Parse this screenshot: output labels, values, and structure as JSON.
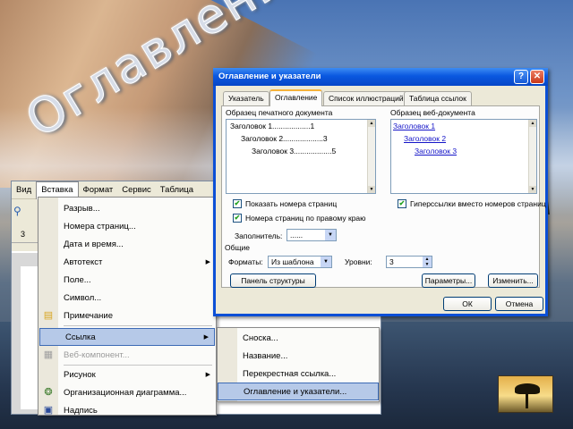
{
  "slide": {
    "title": "Оглавление"
  },
  "word": {
    "menu": [
      "Вид",
      "Вставка",
      "Формат",
      "Сервис",
      "Таблица"
    ],
    "toolbar_number": "3"
  },
  "insert_menu": {
    "items": [
      {
        "label": "Разрыв...",
        "icon": "",
        "arrow": ""
      },
      {
        "label": "Номера страниц...",
        "icon": "",
        "arrow": ""
      },
      {
        "label": "Дата и время...",
        "icon": "",
        "arrow": ""
      },
      {
        "label": "Автотекст",
        "icon": "",
        "arrow": "▶"
      },
      {
        "label": "Поле...",
        "icon": "",
        "arrow": ""
      },
      {
        "label": "Символ...",
        "icon": "",
        "arrow": ""
      },
      {
        "label": "Примечание",
        "icon": "comment-icon",
        "arrow": ""
      },
      {
        "label": "Ссылка",
        "icon": "",
        "arrow": "▶"
      },
      {
        "label": "Веб-компонент...",
        "icon": "web-component-icon",
        "arrow": ""
      },
      {
        "label": "Рисунок",
        "icon": "",
        "arrow": "▶"
      },
      {
        "label": "Организационная диаграмма...",
        "icon": "org-chart-icon",
        "arrow": ""
      },
      {
        "label": "Надпись",
        "icon": "textbox-icon",
        "arrow": ""
      }
    ]
  },
  "reference_submenu": {
    "items": [
      "Сноска...",
      "Название...",
      "Перекрестная ссылка...",
      "Оглавление и указатели..."
    ]
  },
  "dialog": {
    "title": "Оглавление и указатели",
    "help": "?",
    "close": "✕",
    "tabs": [
      "Указатель",
      "Оглавление",
      "Список иллюстраций",
      "Таблица ссылок"
    ],
    "print_preview_label": "Образец печатного документа",
    "web_preview_label": "Образец веб-документа",
    "print_lines": [
      "Заголовок 1..................1",
      "Заголовок 2...................3",
      "Заголовок 3..................5"
    ],
    "web_lines": [
      "Заголовок 1",
      "Заголовок 2",
      "Заголовок 3"
    ],
    "show_page_numbers": "Показать номера страниц",
    "right_align": "Номера страниц по правому краю",
    "hyperlinks": "Гиперссылки вместо номеров страниц",
    "filler_label": "Заполнитель:",
    "filler_value": "......",
    "general_label": "Общие",
    "formats_label": "Форматы:",
    "formats_value": "Из шаблона",
    "levels_label": "Уровни:",
    "levels_value": "3",
    "outline_button": "Панель структуры",
    "options_button": "Параметры...",
    "modify_button": "Изменить...",
    "ok_button": "ОК",
    "cancel_button": "Отмена"
  }
}
